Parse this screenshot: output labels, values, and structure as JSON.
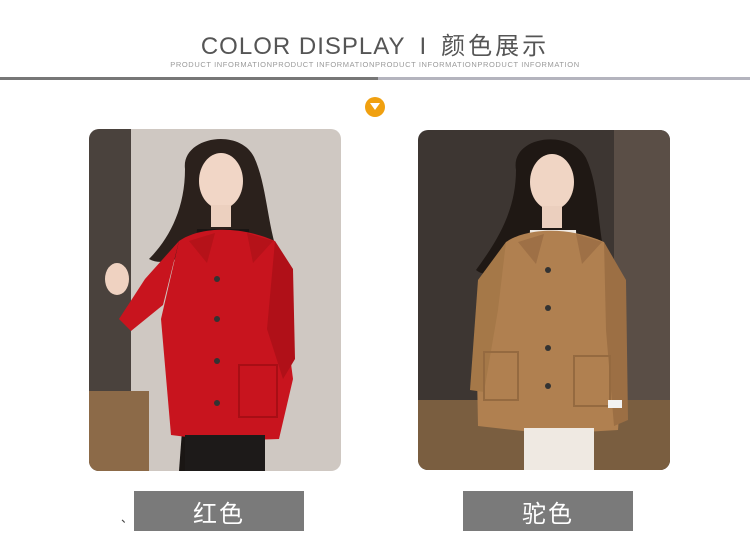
{
  "header": {
    "title_en": "COLOR DISPLAY",
    "separator": "I",
    "title_zh": "颜色展示",
    "subtitle": "PRODUCT INFORMATIONPRODUCT INFORMATIONPRODUCT INFORMATIONPRODUCT INFORMATION"
  },
  "marker": {
    "icon": "chevron-down-icon",
    "color": "#f0a010"
  },
  "products": [
    {
      "color_name": "红色",
      "coat_color": "#c8141e",
      "icon": "red-coat-photo"
    },
    {
      "color_name": "驼色",
      "coat_color": "#b08050",
      "icon": "camel-coat-photo"
    }
  ],
  "stray_mark": "、"
}
